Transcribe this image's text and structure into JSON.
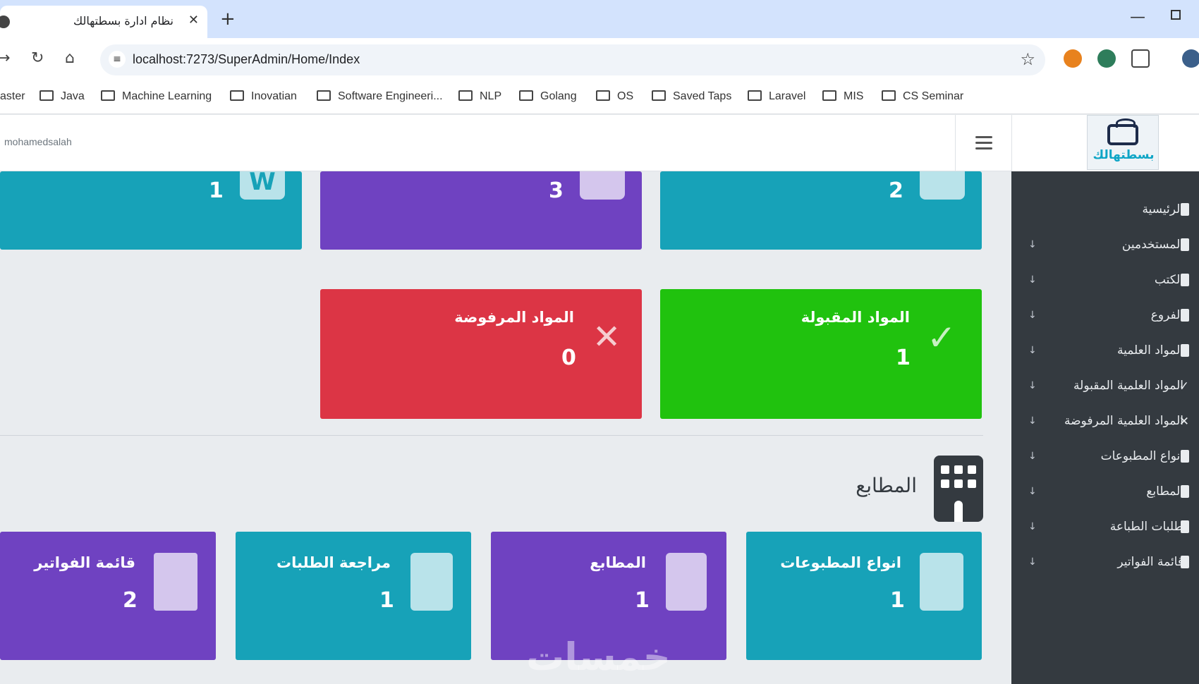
{
  "browser": {
    "tab_title": "نظام ادارة بسطتهالك",
    "tab_close": "✕",
    "new_tab": "+",
    "url": "localhost:7273/SuperAdmin/Home/Index",
    "bookmarks": [
      "aster",
      "Java",
      "Machine Learning",
      "Inovatian",
      "Software Engineeri...",
      "NLP",
      "Golang",
      "OS",
      "Saved Taps",
      "Laravel",
      "MIS",
      "CS Seminar"
    ]
  },
  "header": {
    "username": "mohamedsalah",
    "logo_text": "بسطتهالك"
  },
  "sidebar": {
    "items": [
      {
        "label": "الرئيسية",
        "has_arrow": false
      },
      {
        "label": "المستخدمين",
        "has_arrow": true
      },
      {
        "label": "الكتب",
        "has_arrow": true
      },
      {
        "label": "الفروع",
        "has_arrow": true
      },
      {
        "label": "المواد العلمية",
        "has_arrow": true
      },
      {
        "label": "المواد العلمية المقبولة",
        "has_arrow": true
      },
      {
        "label": "المواد العلمية المرفوضة",
        "has_arrow": true
      },
      {
        "label": "انواع المطبوعات",
        "has_arrow": true
      },
      {
        "label": "المطابع",
        "has_arrow": true
      },
      {
        "label": "طلبات الطباعة",
        "has_arrow": true
      },
      {
        "label": "قائمة الفواتير",
        "has_arrow": true
      }
    ],
    "arrow": "↓"
  },
  "top_cards": {
    "c1": {
      "value": "2"
    },
    "c2": {
      "value": "3"
    },
    "c3": {
      "value": "1",
      "icon_letter": "W"
    }
  },
  "status_cards": {
    "accepted": {
      "label": "المواد المقبولة",
      "value": "1"
    },
    "rejected": {
      "label": "المواد المرفوضة",
      "value": "0"
    }
  },
  "section": {
    "title": "المطابع"
  },
  "bottom_cards": {
    "print_types": {
      "label": "انواع المطبوعات",
      "value": "1"
    },
    "presses": {
      "label": "المطابع",
      "value": "1"
    },
    "review_requests": {
      "label": "مراجعة الطلبات",
      "value": "1"
    },
    "invoices": {
      "label": "قائمة الفواتير",
      "value": "2"
    }
  },
  "watermark": "خمسات",
  "colors": {
    "teal": "#17a2b8",
    "purple": "#6f42c1",
    "red": "#dc3545",
    "green": "#20c20e",
    "sidebar": "#343a40"
  }
}
